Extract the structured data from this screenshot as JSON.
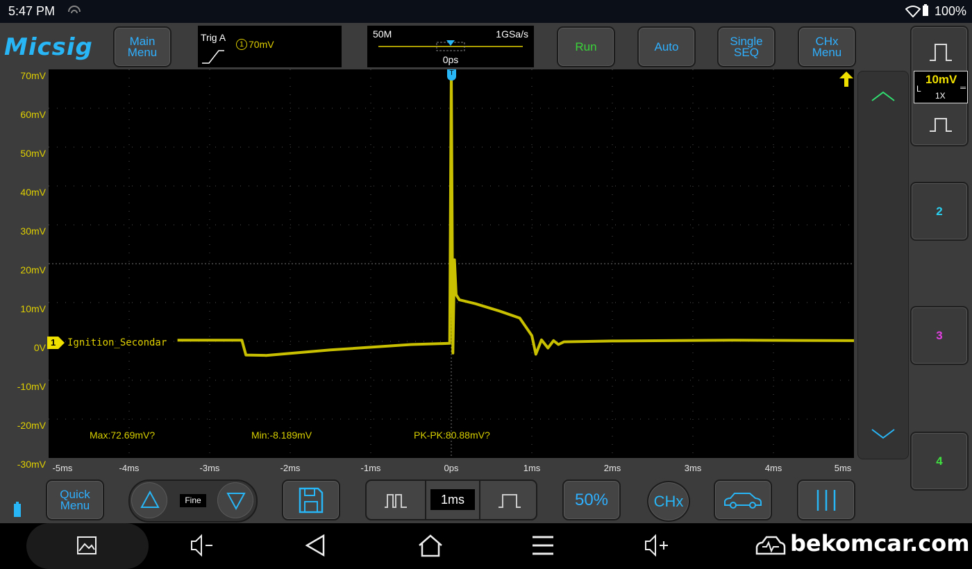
{
  "status": {
    "time": "5:47 PM",
    "battery": "100%"
  },
  "app": {
    "logo": "Micsig"
  },
  "toolbar": {
    "main_menu": "Main\nMenu",
    "trig_label": "Trig A",
    "trig_level": "70mV",
    "trig_channel": "1",
    "memory_depth": "50M",
    "sample_rate": "1GSa/s",
    "time_offset": "0ps",
    "run": "Run",
    "auto": "Auto",
    "single_seq": "Single\nSEQ",
    "chx_menu": "CHx\nMenu"
  },
  "plot": {
    "y_ticks": [
      "70mV",
      "60mV",
      "50mV",
      "40mV",
      "30mV",
      "20mV",
      "10mV",
      "0V",
      "-10mV",
      "-20mV",
      "-30mV"
    ],
    "x_ticks": [
      "-5ms",
      "-4ms",
      "-3ms",
      "-2ms",
      "-1ms",
      "0ps",
      "1ms",
      "2ms",
      "3ms",
      "4ms",
      "5ms"
    ],
    "channel_marker": "1",
    "trace_label": "Ignition_Secondar",
    "trigger_marker": "T",
    "trace_color": "#c8c000",
    "measurements": {
      "max": "Max:72.69mV?",
      "min": "Min:-8.189mV",
      "pkpk": "PK-PK:80.88mV?"
    }
  },
  "right_panel": {
    "ch1_scale": "10mV",
    "ch1_coupling": "L",
    "ch1_probe": "1X",
    "ch2": "2",
    "ch3": "3",
    "ch4": "4",
    "ch2_color": "#29d0f0",
    "ch3_color": "#e040e0",
    "ch4_color": "#40e040"
  },
  "bottom": {
    "quick_menu": "Quick\nMenu",
    "fine": "Fine",
    "timebase": "1ms",
    "fifty": "50%",
    "chx": "CHx"
  },
  "watermark": "bekomcar.com"
}
